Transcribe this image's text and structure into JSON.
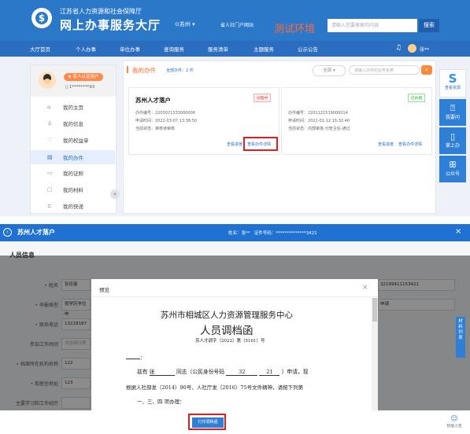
{
  "portal": {
    "org_name": "江苏省人力资源和社会保障厅",
    "site_title": "网上办事服务大厅",
    "city": "苏州",
    "portal_link": "省人社门户网站",
    "test_env": "测试环境",
    "search_placeholder": "请输入您要搜索的内容",
    "search_button": "搜索",
    "user_name": "张**",
    "nav": [
      "大厅首页",
      "个人办事",
      "单位办事",
      "查询服务",
      "服务清单",
      "主题服务",
      "公示公告"
    ],
    "user_panel": {
      "verified_badge": "★ 实人认证用户",
      "phone": "1********93"
    },
    "menu": [
      "我的主页",
      "我的信息",
      "我的权益单",
      "我的办件",
      "我的证照",
      "我的材料",
      "我的快递"
    ],
    "active_menu_index": 3,
    "my_cases": {
      "title": "我的办件",
      "count_text": "全部办件：2 件",
      "filter_label": "全部",
      "filter_placeholder": "请输入办件的业务名称",
      "items": [
        {
          "title": "苏州人才落户",
          "status": "办理中",
          "case_no": "办件编号：2203071333000006",
          "apply_time": "申请时间：2022-03-07 13:38:50",
          "current_status": "当前状态：审核待审核",
          "link_progress": "查看进度",
          "link_detail": "查看办件详情"
        },
        {
          "title": "",
          "status": "已办结",
          "case_no": "办件编号：2201121519000014",
          "apply_time": "申请时间：2022-01-12 15:32:40",
          "current_status": "当前状态：内部审批-分管主任-通过",
          "link_progress": "查看进度",
          "link_detail": "查看办件详情"
        }
      ]
    },
    "side_buttons": [
      "查看资源",
      "我要问",
      "掌上办",
      "公众号"
    ]
  },
  "modal": {
    "title": "苏州人才落户",
    "name_label": "姓名：",
    "name_value": "张**",
    "id_label": "证件号码：",
    "id_value": "**************3421",
    "section": "人员信息",
    "fields": [
      {
        "label": "姓名",
        "value": "张佳曼",
        "required": true
      },
      {
        "label": "申报类型",
        "value": "按学历学位申",
        "required": true
      },
      {
        "label": "联系电话",
        "value": "13218187",
        "required": true
      },
      {
        "label": "参加工作时间",
        "value": "请选择日期",
        "required": false
      },
      {
        "label": "档案所在机构名称",
        "value": "122",
        "required": true
      },
      {
        "label": "现居住地址",
        "value": "123",
        "required": true
      },
      {
        "label": "主要学习和工作经历",
        "value": "",
        "required": false
      }
    ],
    "right_field_value": "32199411153421",
    "right_field_value2": "申请",
    "float_tab": "材料列表",
    "print_button": "打印调档函",
    "smart_assistant": "智能小宝"
  },
  "preview": {
    "title": "预览",
    "close": "×",
    "doc_org": "苏州市相城区人力资源管理服务中心",
    "doc_title": "人员调档函",
    "doc_no": "苏人才调字（2022）第（5161）号",
    "addressee": "：",
    "line1_a": "兹有",
    "line1_name": "张",
    "line1_b": "同志（公民身份号码",
    "line1_id_a": "32",
    "line1_id_b": "21",
    "line1_c": "）申请，现",
    "line2": "根据人社部发（2014）90号、人社厅发（2016）75号文件精神，请按下列第",
    "line3": "一、三、四    项办理："
  }
}
